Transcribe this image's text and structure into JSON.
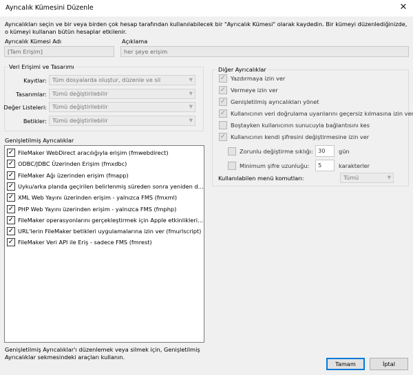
{
  "window": {
    "title": "Ayrıcalık Kümesini Düzenle",
    "close_glyph": "✕"
  },
  "description": "Ayrıcalıkları seçin ve bir veya birden çok hesap tarafından kullanılabilecek bir \"Ayrıcalık Kümesi\" olarak kaydedin. Bir kümeyi düzenlediğinizde, o kümeyi kullanan bütün hesaplar etkilenir.",
  "name_field": {
    "label": "Ayrıcalık Kümesi Adı",
    "value": "[Tam Erişim]"
  },
  "desc_field": {
    "label": "Açıklama",
    "value": "her şeye erişim"
  },
  "data_access": {
    "legend": "Veri Erişimi ve Tasarımı",
    "rows": [
      {
        "label": "Kayıtlar:",
        "value": "Tüm dosyalarda oluştur, düzenle ve sil"
      },
      {
        "label": "Tasarımlar:",
        "value": "Tümü değiştirilebilir"
      },
      {
        "label": "Değer Listeleri:",
        "value": "Tümü değiştirilebilir"
      },
      {
        "label": "Betikler:",
        "value": "Tümü değiştirilebilir"
      }
    ]
  },
  "extended": {
    "legend": "Genişletilmiş Ayrıcalıklar",
    "items": [
      "FileMaker WebDirect aracılığıyla erişim (fmwebdirect)",
      "ODBC/JDBC Üzerinden Erişim (fmxdbc)",
      "FileMaker Ağı üzerinden erişim (fmapp)",
      "Uyku/arka planda geçirilen belirlenmiş süreden sonra yeniden do...",
      "XML Web Yayını üzerinden erişim - yalnızca FMS (fmxml)",
      "PHP Web Yayını üzerinden erişim - yalnızca FMS (fmphp)",
      "FileMaker operasyonlarını gerçekleştirmek için Apple etkinliklerine...",
      "URL'lerin FileMaker betikleri uygulamalarına izin ver (fmurlscript)",
      "FileMaker Veri API ile Eriş - sadece FMS (fmrest)"
    ],
    "checked_glyph": "✓",
    "footer": "Genişletilmiş Ayrıcalıklar'ı düzenlemek veya silmek için, Genişletilmiş Ayrıcalıklar sekmesindeki araçları kullanın."
  },
  "other": {
    "legend": "Diğer Ayrıcalıklar",
    "options": [
      {
        "label": "Yazdırmaya izin ver",
        "checked": true
      },
      {
        "label": "Vermeye izin ver",
        "checked": true
      },
      {
        "label": "Genişletilmiş ayrıcalıkları yönet",
        "checked": true
      },
      {
        "label": "Kullanıcının veri doğrulama uyarılarını geçersiz kılmasına izin ver",
        "checked": true
      },
      {
        "label": "Boştayken kullanıcının sunucuyla bağlantısını kes",
        "checked": false
      },
      {
        "label": "Kullanıcının kendi şifresini değiştirmesine izin ver",
        "checked": true
      }
    ],
    "change_freq": {
      "label": "Zorunlu değiştirme sıklığı:",
      "value": "30",
      "unit": "gün"
    },
    "min_len": {
      "label": "Minimum şifre uzunluğu:",
      "value": "5",
      "unit": "karakterler"
    },
    "menu": {
      "label": "Kullanılabilen menü komutları:",
      "value": "Tümü"
    }
  },
  "buttons": {
    "ok": "Tamam",
    "cancel": "İptal"
  },
  "dropdown_glyph": "▼"
}
